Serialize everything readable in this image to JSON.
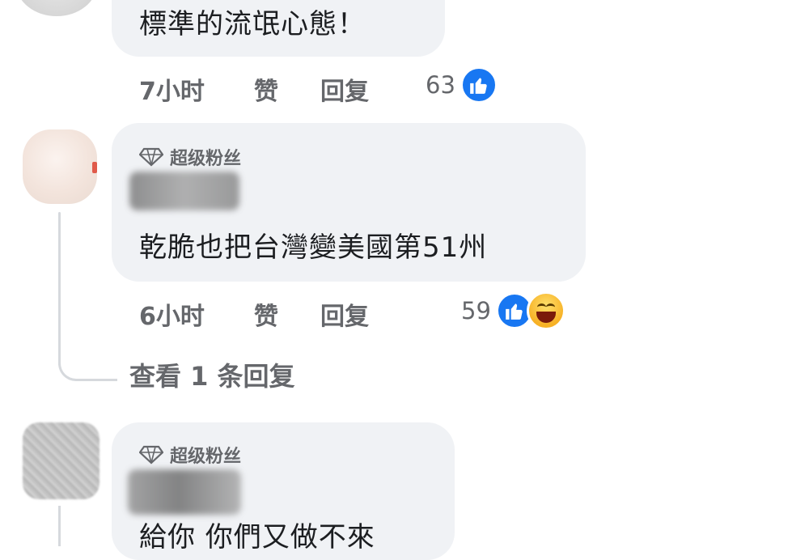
{
  "comments": [
    {
      "text": "標準的流氓心態！",
      "time": "7小时",
      "like_label": "赞",
      "reply_label": "回复",
      "reaction_count": "63",
      "reactions": [
        "like"
      ]
    },
    {
      "badge": "超级粉丝",
      "text": "乾脆也把台灣變美國第51州",
      "time": "6小时",
      "like_label": "赞",
      "reply_label": "回复",
      "reaction_count": "59",
      "reactions": [
        "like",
        "haha"
      ]
    },
    {
      "badge": "超级粉丝",
      "text": "給你 你們又做不來"
    }
  ],
  "view_replies": "查看 1 条回复",
  "colors": {
    "bubble": "#f0f2f5",
    "secondary_text": "#65676b",
    "like_blue": "#1877f2",
    "haha_yellow": "#f7b125",
    "thread_line": "#d6d9dd"
  },
  "icons": [
    "diamond-badge-icon",
    "like-reaction-icon",
    "haha-reaction-icon"
  ]
}
